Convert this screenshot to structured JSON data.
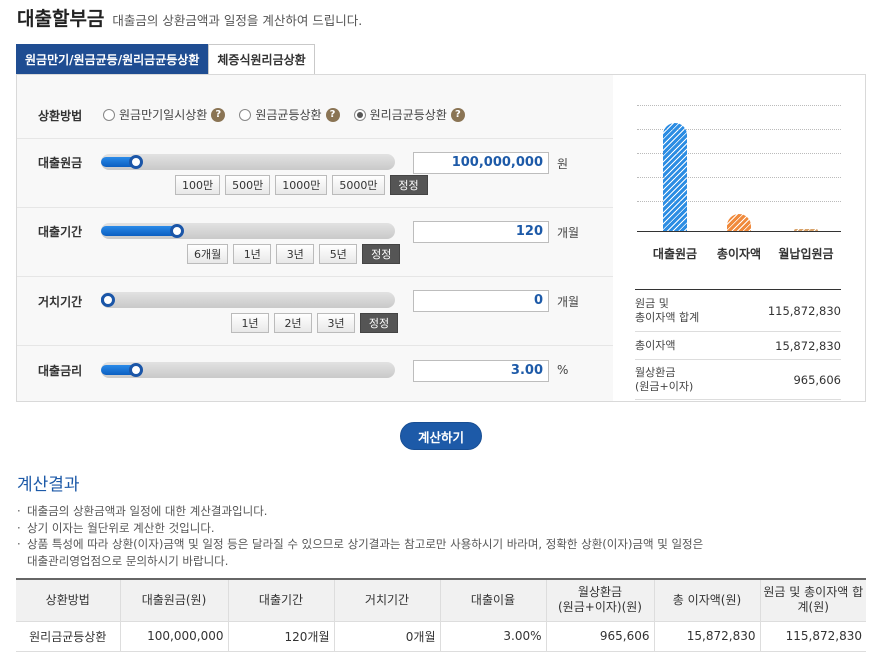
{
  "header": {
    "title": "대출할부금",
    "subtitle": "대출금의 상환금액과 일정을 계산하여 드립니다."
  },
  "tabs": [
    {
      "label": "원금만기/원금균등/원리금균등상환",
      "active": true
    },
    {
      "label": "체증식원리금상환",
      "active": false
    }
  ],
  "method": {
    "label": "상환방법",
    "options": [
      {
        "label": "원금만기일시상환",
        "selected": false
      },
      {
        "label": "원금균등상환",
        "selected": false
      },
      {
        "label": "원리금균등상환",
        "selected": true
      }
    ],
    "help_glyph": "?"
  },
  "loan_amount": {
    "label": "대출원금",
    "value": "100,000,000",
    "unit": "원",
    "slider_fraction": 0.12,
    "buttons": [
      "100만",
      "500만",
      "1000만",
      "5000만",
      "정정"
    ]
  },
  "loan_period": {
    "label": "대출기간",
    "value": "120",
    "unit": "개월",
    "slider_fraction": 0.26,
    "buttons": [
      "6개월",
      "1년",
      "3년",
      "5년",
      "정정"
    ]
  },
  "grace_period": {
    "label": "거치기간",
    "value": "0",
    "unit": "개월",
    "slider_fraction": 0.025,
    "buttons": [
      "1년",
      "2년",
      "3년",
      "정정"
    ]
  },
  "interest_rate": {
    "label": "대출금리",
    "value": "3.00",
    "unit": "%",
    "slider_fraction": 0.12
  },
  "chart_data": {
    "type": "bar",
    "categories": [
      "대출원금",
      "총이자액",
      "월납입원금"
    ],
    "values": [
      100000000,
      15872830,
      965606
    ],
    "colors": [
      "#2c8de3",
      "#f08a3c",
      "#d9a36a"
    ]
  },
  "summary": [
    {
      "label_line1": "원금 및",
      "label_line2": "총이자액 합계",
      "value": "115,872,830"
    },
    {
      "label_line1": "총이자액",
      "label_line2": "",
      "value": "15,872,830"
    },
    {
      "label_line1": "월상환금",
      "label_line2": "(원금+이자)",
      "value": "965,606"
    }
  ],
  "calc_button": "계산하기",
  "result": {
    "title": "계산결과",
    "notes": [
      "대출금의 상환금액과 일정에 대한 계산결과입니다.",
      "상기 이자는 월단위로 계산한 것입니다.",
      "상품 특성에 따라 상환(이자)금액 및 일정 등은 달라질 수 있으므로 상기결과는 참고로만 사용하시기 바라며, 정확한 상환(이자)금액 및 일정은",
      "대출관리영업점으로 문의하시기 바랍니다."
    ],
    "columns": [
      {
        "line1": "상환방법",
        "line2": ""
      },
      {
        "line1": "대출원금(원)",
        "line2": ""
      },
      {
        "line1": "대출기간",
        "line2": ""
      },
      {
        "line1": "거치기간",
        "line2": ""
      },
      {
        "line1": "대출이율",
        "line2": ""
      },
      {
        "line1": "월상환금",
        "line2": "(원금+이자)(원)"
      },
      {
        "line1": "총 이자액(원)",
        "line2": ""
      },
      {
        "line1": "원금 및 총이자액 합",
        "line2": "계(원)"
      }
    ],
    "row": [
      "원리금균등상환",
      "100,000,000",
      "120개월",
      "0개월",
      "3.00%",
      "965,606",
      "15,872,830",
      "115,872,830"
    ]
  }
}
